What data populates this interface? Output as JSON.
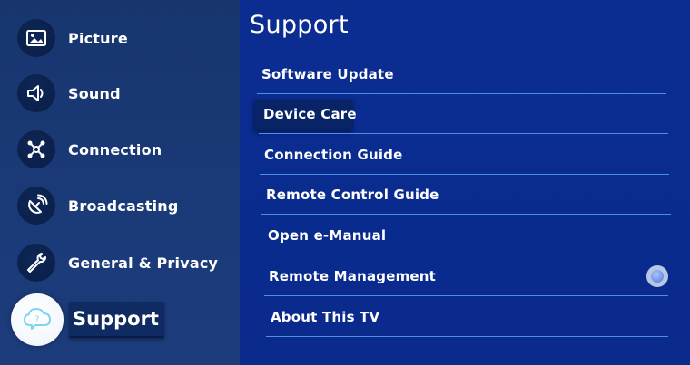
{
  "sidebar": {
    "items": [
      {
        "label": "Picture",
        "icon": "picture-icon"
      },
      {
        "label": "Sound",
        "icon": "sound-icon"
      },
      {
        "label": "Connection",
        "icon": "connection-icon"
      },
      {
        "label": "Broadcasting",
        "icon": "broadcasting-icon"
      },
      {
        "label": "General & Privacy",
        "icon": "wrench-icon"
      },
      {
        "label": "Support",
        "icon": "support-icon",
        "selected": true
      }
    ]
  },
  "main": {
    "title": "Support",
    "items": [
      {
        "label": "Software Update"
      },
      {
        "label": "Device Care",
        "focused": true
      },
      {
        "label": "Connection Guide"
      },
      {
        "label": "Remote Control Guide"
      },
      {
        "label": "Open e-Manual"
      },
      {
        "label": "Remote Management",
        "has_radio": true
      },
      {
        "label": "About This TV"
      }
    ]
  },
  "colors": {
    "main_bg": "#0a2a8c",
    "sidebar_bg": "#18356e",
    "divider": "#4f8cf0",
    "focus_bg": "#082466",
    "icon_circle": "#0a1e46",
    "selected_circle": "#ffffff",
    "support_cloud": "#7fd3f0"
  }
}
